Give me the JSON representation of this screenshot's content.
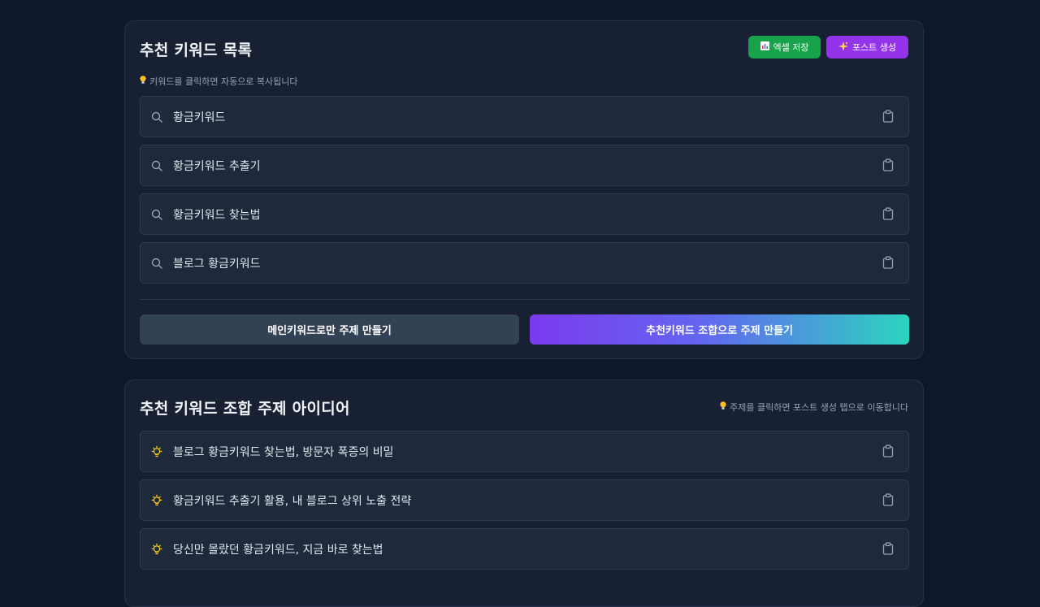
{
  "keywords_card": {
    "title": "추천 키워드 목록",
    "hint": "키워드를 클릭하면 자동으로 복사됩니다",
    "excel_button": "엑셀 저장",
    "post_button": "포스트 생성",
    "items": [
      "황금키워드",
      "황금키워드 추출기",
      "황금키워드 찾는법",
      "블로그 황금키워드"
    ],
    "main_only_button": "메인키워드로만 주제 만들기",
    "combo_button": "추천키워드 조합으로 주제 만들기"
  },
  "ideas_card": {
    "title": "추천 키워드 조합 주제 아이디어",
    "hint": "주제를 클릭하면 포스트 생성 탭으로 이동합니다",
    "items": [
      "블로그 황금키워드 찾는법, 방문자 폭증의 비밀",
      "황금키워드 추출기 활용, 내 블로그 상위 노출 전략",
      "당신만 몰랐던 황금키워드, 지금 바로 찾는법"
    ]
  },
  "icons": {
    "search": "search-icon",
    "clipboard": "clipboard-icon",
    "lightbulb": "lightbulb-icon",
    "excel": "bar-chart-icon",
    "sparkle": "sparkle-icon"
  },
  "colors": {
    "background": "#0f172a",
    "card": "#172133",
    "excel_green": "#16a34a",
    "post_purple": "#9333ea",
    "gradient_start": "#7c3aed",
    "gradient_end": "#2dd4bf",
    "bulb_yellow": "#fbbf24"
  }
}
